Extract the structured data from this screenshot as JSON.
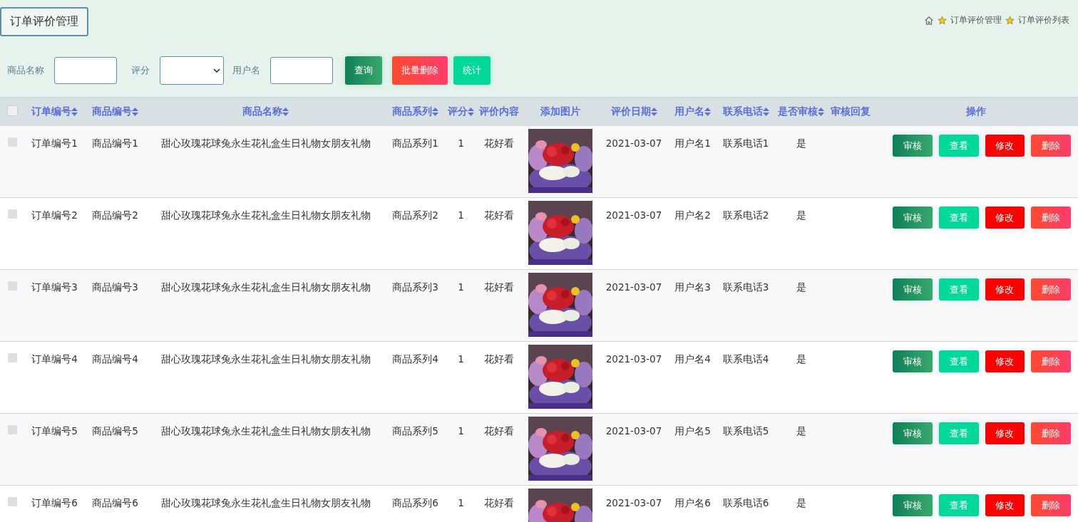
{
  "page_title": "订单评价管理",
  "breadcrumb": [
    "订单评价管理",
    "订单评价列表"
  ],
  "search": {
    "fields": [
      {
        "label": "商品名称",
        "kind": "text"
      },
      {
        "label": "评分",
        "kind": "select"
      },
      {
        "label": "用户名",
        "kind": "text"
      }
    ],
    "buttons": [
      {
        "label": "查询",
        "kind": "primary"
      },
      {
        "label": "批量删除",
        "kind": "danger"
      },
      {
        "label": "统计",
        "kind": "info"
      }
    ]
  },
  "table": {
    "select_all": {
      "checked": false
    },
    "columns": [
      {
        "label": "订单编号",
        "sortable": true
      },
      {
        "label": "商品编号",
        "sortable": true
      },
      {
        "label": "商品名称",
        "sortable": true
      },
      {
        "label": "商品系列",
        "sortable": true
      },
      {
        "label": "评分",
        "sortable": true
      },
      {
        "label": "评价内容",
        "sortable": false
      },
      {
        "label": "添加图片",
        "sortable": false
      },
      {
        "label": "评价日期",
        "sortable": true
      },
      {
        "label": "用户名",
        "sortable": true
      },
      {
        "label": "联系电话",
        "sortable": true
      },
      {
        "label": "是否审核",
        "sortable": true
      },
      {
        "label": "审核回复",
        "sortable": false
      },
      {
        "label": "操作",
        "sortable": false
      }
    ],
    "rows": [
      {
        "checked": false,
        "cells": [
          "订单编号1",
          "商品编号1",
          "甜心玫瑰花球兔永生花礼盒生日礼物女朋友礼物",
          "商品系列1",
          "1",
          "花好看",
          {
            "kind": "picture"
          },
          "2021-03-07",
          "用户名1",
          "联系电话1",
          "是",
          ""
        ],
        "actions": [
          {
            "label": "审核",
            "kind": "review"
          },
          {
            "label": "查看",
            "kind": "view"
          },
          {
            "label": "修改",
            "kind": "edit"
          },
          {
            "label": "删除",
            "kind": "delete"
          }
        ]
      },
      {
        "checked": false,
        "cells": [
          "订单编号2",
          "商品编号2",
          "甜心玫瑰花球兔永生花礼盒生日礼物女朋友礼物",
          "商品系列2",
          "1",
          "花好看",
          {
            "kind": "picture"
          },
          "2021-03-07",
          "用户名2",
          "联系电话2",
          "是",
          ""
        ],
        "actions": [
          {
            "label": "审核",
            "kind": "review"
          },
          {
            "label": "查看",
            "kind": "view"
          },
          {
            "label": "修改",
            "kind": "edit"
          },
          {
            "label": "删除",
            "kind": "delete"
          }
        ]
      },
      {
        "checked": false,
        "cells": [
          "订单编号3",
          "商品编号3",
          "甜心玫瑰花球兔永生花礼盒生日礼物女朋友礼物",
          "商品系列3",
          "1",
          "花好看",
          {
            "kind": "picture"
          },
          "2021-03-07",
          "用户名3",
          "联系电话3",
          "是",
          ""
        ],
        "actions": [
          {
            "label": "审核",
            "kind": "review"
          },
          {
            "label": "查看",
            "kind": "view"
          },
          {
            "label": "修改",
            "kind": "edit"
          },
          {
            "label": "删除",
            "kind": "delete"
          }
        ]
      },
      {
        "checked": false,
        "cells": [
          "订单编号4",
          "商品编号4",
          "甜心玫瑰花球兔永生花礼盒生日礼物女朋友礼物",
          "商品系列4",
          "1",
          "花好看",
          {
            "kind": "picture"
          },
          "2021-03-07",
          "用户名4",
          "联系电话4",
          "是",
          ""
        ],
        "actions": [
          {
            "label": "审核",
            "kind": "review"
          },
          {
            "label": "查看",
            "kind": "view"
          },
          {
            "label": "修改",
            "kind": "edit"
          },
          {
            "label": "删除",
            "kind": "delete"
          }
        ]
      },
      {
        "checked": false,
        "cells": [
          "订单编号5",
          "商品编号5",
          "甜心玫瑰花球兔永生花礼盒生日礼物女朋友礼物",
          "商品系列5",
          "1",
          "花好看",
          {
            "kind": "picture"
          },
          "2021-03-07",
          "用户名5",
          "联系电话5",
          "是",
          ""
        ],
        "actions": [
          {
            "label": "审核",
            "kind": "review"
          },
          {
            "label": "查看",
            "kind": "view"
          },
          {
            "label": "修改",
            "kind": "edit"
          },
          {
            "label": "删除",
            "kind": "delete"
          }
        ]
      },
      {
        "checked": false,
        "cells": [
          "订单编号6",
          "商品编号6",
          "甜心玫瑰花球兔永生花礼盒生日礼物女朋友礼物",
          "商品系列6",
          "1",
          "花好看",
          {
            "kind": "picture"
          },
          "2021-03-07",
          "用户名6",
          "联系电话6",
          "是",
          ""
        ],
        "actions": [
          {
            "label": "审核",
            "kind": "review"
          },
          {
            "label": "查看",
            "kind": "view"
          },
          {
            "label": "修改",
            "kind": "edit"
          },
          {
            "label": "删除",
            "kind": "delete"
          }
        ]
      }
    ]
  }
}
